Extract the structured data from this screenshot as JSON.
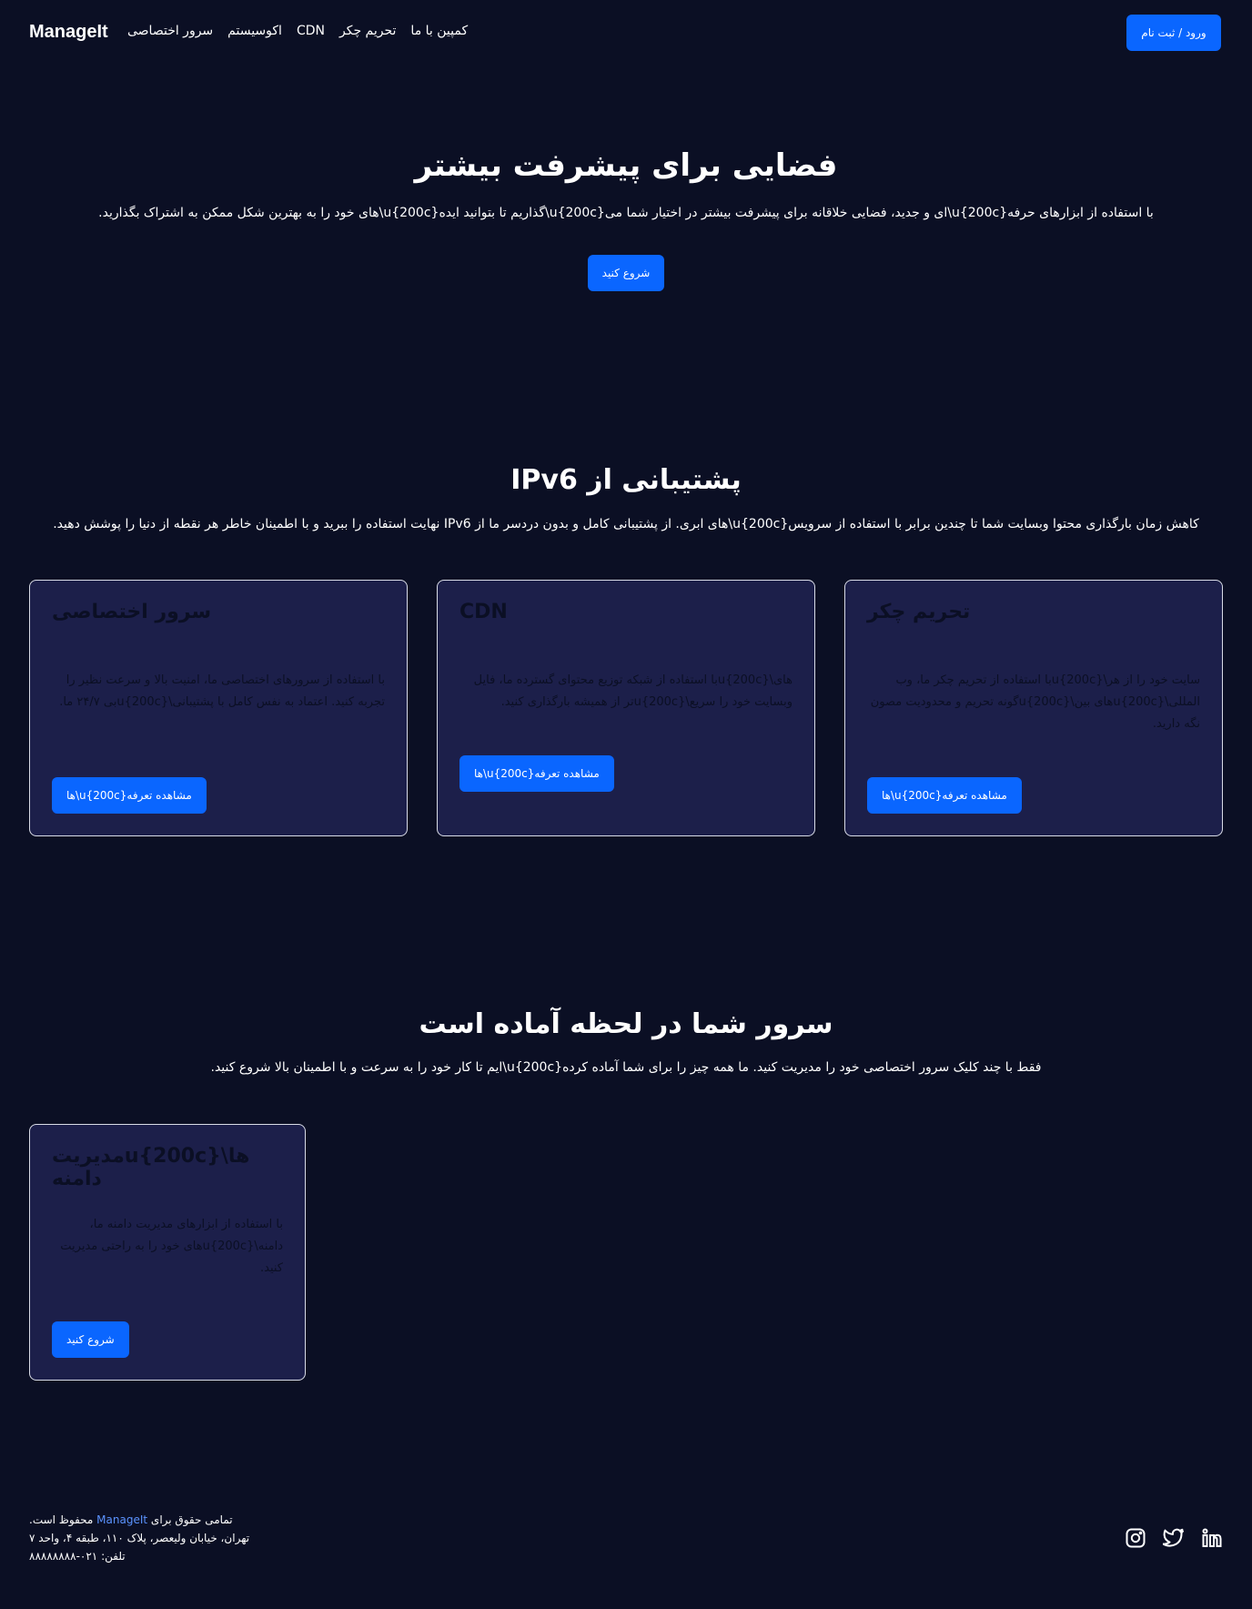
{
  "nav": {
    "brand": "ManageIt",
    "links": [
      "سرور اختصاصی",
      "اکوسیستم",
      "CDN",
      "تحریم چکر",
      "کمپین با ما"
    ],
    "login": "ورود / ثبت نام"
  },
  "hero": {
    "title": "فضایی برای پیشرفت بیشتر",
    "subtitle": ".های خود را به بهترین شکل ممکن به اشتراک بگذارید\\u{200c}گذاریم تا بتوانید ایده\\u{200c}ای و جدید، فضایی خلاقانه برای پیشرفت بیشتر در اختیار شما می\\u{200c}با استفاده از ابزارهای حرفه",
    "button": "شروع کنید"
  },
  "ipv6": {
    "title": "IPv6 پشتیبانی از",
    "subtitle": ".نهایت استفاده را ببرید و با اطمینان خاطر هر نقطه از دنیا را پوشش دهید IPv6 های ابری. از پشتیبانی کامل و بدون دردسر ما از\\u{200c}کاهش زمان بارگذاری محتوا وبسایت شما تا چندین برابر با استفاده از سرویس",
    "cards": [
      {
        "title": "سرور اختصاصی",
        "desc": "با استفاده از سرورهای اختصاصی ما، امنیت بالا و سرعت نظیر را تجربه کنید. اعتماد به نفس کامل با پشتیبانی\\u{200c}بی ۲۴/۷ ما.",
        "button": "ها\\u{200c}مشاهده تعرفه"
      },
      {
        "title": "CDN",
        "desc": "های\\u{200c}با استفاده از شبکه توزیع محتوای گسترده ما، فایل وبسایت خود را سریع\\u{200c}تر از همیشه بارگذاری کنید.",
        "button": "ها\\u{200c}مشاهده تعرفه"
      },
      {
        "title": "تحریم چکر",
        "desc": "سایت خود را از هر\\u{200c}با استفاده از تحریم چکر ما، وب المللی\\u{200c}های بین\\u{200c}گونه تحریم و محدودیت مصون نگه دارید.",
        "button": "ها\\u{200c}مشاهده تعرفه"
      }
    ]
  },
  "server": {
    "title": "سرور شما در لحظه آماده است",
    "subtitle": ".ایم تا کار خود را به سرعت و با اطمینان بالا شروع کنید\\u{200c}فقط با چند کلیک سرور اختصاصی خود را مدیریت کنید. ما همه چیز را برای شما آماده کرده",
    "card": {
      "title": "ها\\u{200c}مدیریت دامنه",
      "desc": "با استفاده از ابزارهای مدیریت دامنه ما، دامنه\\u{200c}های خود را به راحتی مدیریت کنید.",
      "button": "شروع کنید"
    }
  },
  "footer": {
    "rights_prefix": "تمامی حقوق برای",
    "rights_brand": "ManageIt",
    "rights_suffix": "محفوظ است.",
    "address": "تهران، خیابان ولیعصر، پلاک ۱۱۰، طبقه ۴، واحد ۷",
    "phone": "تلفن: ۰۲۱-۸۸۸۸۸۸۸۸",
    "socials": [
      "instagram-icon",
      "twitter-icon",
      "linkedin-icon"
    ]
  },
  "colors": {
    "background": "#0b0f24",
    "card": "#1c1f4a",
    "accent": "#0a66ff",
    "link": "#5b93ff"
  }
}
